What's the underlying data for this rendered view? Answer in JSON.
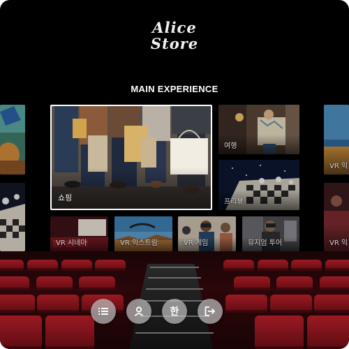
{
  "logo": {
    "line1": "Alice",
    "line2": "Store"
  },
  "section": {
    "title": "MAIN EXPERIENCE"
  },
  "tiles": {
    "featured": {
      "label": "쇼핑"
    },
    "travel": {
      "label": "여행"
    },
    "preview": {
      "label": "프리뷰"
    },
    "cinema": {
      "label": "VR 시네마"
    },
    "extreme": {
      "label": "VR 익스트림"
    },
    "game": {
      "label": "VR 게임"
    },
    "museum": {
      "label": "뮤지엄 투어"
    },
    "right_top": {
      "label": "VR 익"
    },
    "right_bottom": {
      "label": "VR 익"
    }
  },
  "toolbar": {
    "language_label": "한",
    "menu_icon": "list-icon",
    "profile_icon": "user-icon",
    "logout_icon": "logout-icon"
  },
  "colors": {
    "background": "#000000",
    "seat_red": "#8e1620",
    "button_gray": "#bebebe",
    "featured_border": "#ffffff"
  }
}
